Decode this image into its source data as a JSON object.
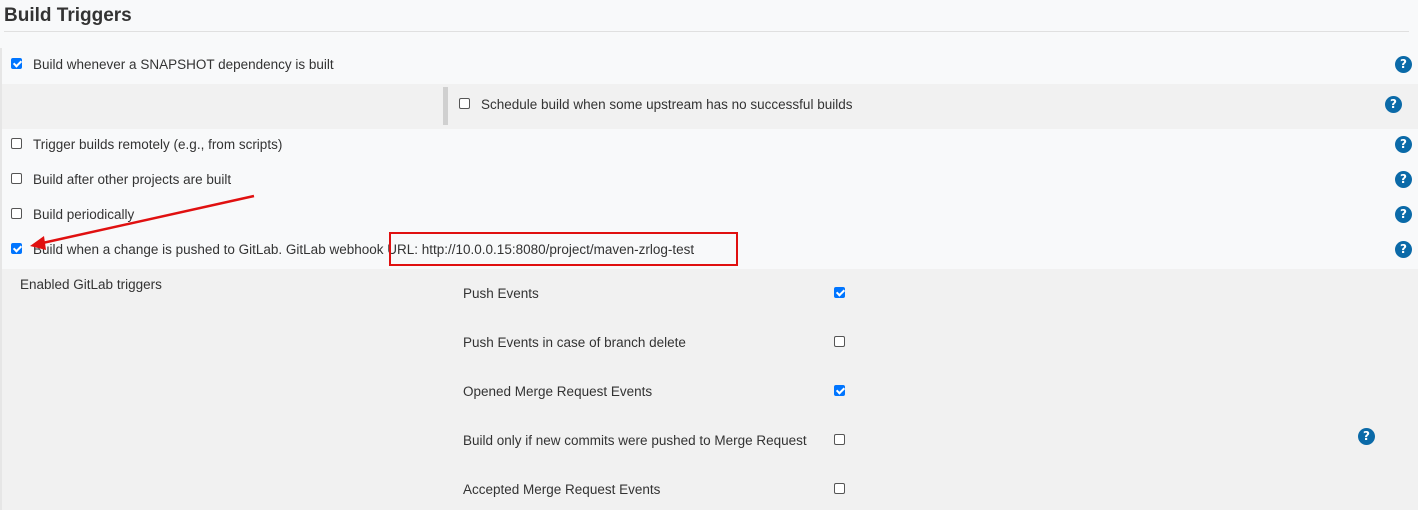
{
  "section": {
    "title": "Build Triggers"
  },
  "triggers": [
    {
      "label": "Build whenever a SNAPSHOT dependency is built",
      "checked": true
    },
    {
      "label": "Schedule build when some upstream has no successful builds",
      "checked": false
    },
    {
      "label": "Trigger builds remotely (e.g., from scripts)",
      "checked": false
    },
    {
      "label": "Build after other projects are built",
      "checked": false
    },
    {
      "label": "Build periodically",
      "checked": false
    },
    {
      "label": "Build when a change is pushed to GitLab. GitLab webhook ",
      "url_text": "URL: http://10.0.0.15:8080/project/maven-zrlog-test",
      "checked": true
    }
  ],
  "gitlab": {
    "heading": "Enabled GitLab triggers",
    "options": [
      {
        "label": "Push Events",
        "checked": true
      },
      {
        "label": "Push Events in case of branch delete",
        "checked": false
      },
      {
        "label": "Opened Merge Request Events",
        "checked": true
      },
      {
        "label": "Build only if new commits were pushed to Merge Request",
        "checked": false
      },
      {
        "label": "Accepted Merge Request Events",
        "checked": false
      }
    ]
  },
  "help_glyph": "?",
  "colors": {
    "accent": "#0075ff",
    "help": "#0b6aa8",
    "annotation": "#e01010"
  }
}
